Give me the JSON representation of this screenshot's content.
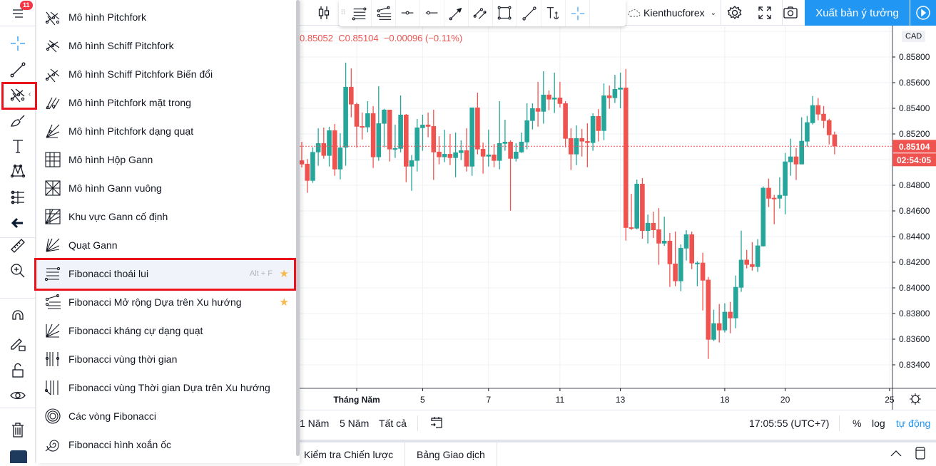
{
  "left_toolbar": {
    "notification_count": "11",
    "tools": [
      "menu-icon",
      "crosshair-icon",
      "trend-line-icon",
      "pitchfork-icon",
      "brush-icon",
      "text-icon",
      "pattern-icon",
      "prediction-icon",
      "back-arrow-icon",
      "ruler-icon",
      "zoom-in-icon",
      "magnet-icon",
      "lock-drawing-icon",
      "unlock-icon",
      "eye-icon",
      "trash-icon"
    ]
  },
  "menu": {
    "items": [
      {
        "label": "Mô hình Pitchfork",
        "icon": "pitchfork-icon"
      },
      {
        "label": "Mô hình Schiff Pitchfork",
        "icon": "schiff-pitchfork-icon"
      },
      {
        "label": "Mô hình Schiff Pitchfork Biến đổi",
        "icon": "modified-schiff-pitchfork-icon"
      },
      {
        "label": "Mô hình Pitchfork mặt trong",
        "icon": "inside-pitchfork-icon"
      },
      {
        "label": "Mô hình Pitchfork dạng quạt",
        "icon": "pitchfan-icon"
      },
      {
        "label": "Mô hình Hộp Gann",
        "icon": "gann-box-icon"
      },
      {
        "label": "Mô hình Gann vuông",
        "icon": "gann-square-icon"
      },
      {
        "label": "Khu vực Gann cố định",
        "icon": "gann-fixed-icon"
      },
      {
        "label": "Quạt Gann",
        "icon": "gann-fan-icon"
      },
      {
        "label": "Fibonacci thoái lui",
        "icon": "fib-retracement-icon",
        "shortcut": "Alt + F",
        "favorite": true,
        "selected": true
      },
      {
        "label": "Fibonacci Mở rộng Dựa trên Xu hướng",
        "icon": "fib-extension-icon",
        "favorite": true
      },
      {
        "label": "Fibonacci kháng cự dạng quạt",
        "icon": "fib-fan-icon"
      },
      {
        "label": "Fibonacci vùng thời gian",
        "icon": "fib-time-zone-icon"
      },
      {
        "label": "Fibonacci vùng Thời gian Dựa trên Xu hướng",
        "icon": "fib-trend-time-icon"
      },
      {
        "label": "Các vòng Fibonacci",
        "icon": "fib-circles-icon"
      },
      {
        "label": "Fibonacci hình xoắn ốc",
        "icon": "fib-spiral-icon"
      }
    ]
  },
  "top_toolbar": {
    "symbol": "Kienthucforex",
    "publish_label": "Xuất bản ý tưởng",
    "float_tools": [
      "fib-retracement-icon",
      "fib-extension-icon",
      "horizontal-ray-icon",
      "horizontal-line-icon",
      "arrow-icon",
      "parallel-channel-icon",
      "rectangle-icon",
      "trend-line-icon",
      "anchored-text-icon",
      "crosshair-icon"
    ]
  },
  "legend": {
    "text": "0.85052  C0.85104  −0.00096 (−0.11%)"
  },
  "currency": "CAD",
  "colors": {
    "up": "#26a69a",
    "down": "#ef5350",
    "accent": "#2196f3",
    "highlight": "#e8131b"
  },
  "chart_data": {
    "type": "candlestick",
    "price_ticks": [
      "0.85800",
      "0.85600",
      "0.85400",
      "0.85200",
      "0.84800",
      "0.84600",
      "0.84400",
      "0.84200",
      "0.84000",
      "0.83800",
      "0.83600",
      "0.83400"
    ],
    "x_ticks": [
      {
        "label": "Tháng Năm",
        "index": 10
      },
      {
        "label": "5",
        "index": 22
      },
      {
        "label": "7",
        "index": 34
      },
      {
        "label": "11",
        "index": 47
      },
      {
        "label": "13",
        "index": 58
      },
      {
        "label": "18",
        "index": 77
      },
      {
        "label": "20",
        "index": 88
      },
      {
        "label": "25",
        "index": 107
      }
    ],
    "last_price": "0.85104",
    "countdown": "02:54:05",
    "ylim": [
      0.833,
      0.859
    ],
    "candles": [
      [
        0.84994,
        0.85139,
        0.84939,
        0.84963
      ],
      [
        0.84967,
        0.85004,
        0.84741,
        0.84835
      ],
      [
        0.84835,
        0.85096,
        0.84819,
        0.85059
      ],
      [
        0.85057,
        0.85244,
        0.84952,
        0.85128
      ],
      [
        0.85128,
        0.8525,
        0.85007,
        0.8503
      ],
      [
        0.8503,
        0.85256,
        0.84946,
        0.85228
      ],
      [
        0.85228,
        0.85278,
        0.84874,
        0.84924
      ],
      [
        0.84924,
        0.85206,
        0.84846,
        0.85094
      ],
      [
        0.85094,
        0.85756,
        0.84952,
        0.85567
      ],
      [
        0.85567,
        0.85711,
        0.8533,
        0.8543
      ],
      [
        0.85433,
        0.85444,
        0.85093,
        0.85257
      ],
      [
        0.85261,
        0.85367,
        0.85157,
        0.85252
      ],
      [
        0.85252,
        0.85456,
        0.85213,
        0.85361
      ],
      [
        0.85361,
        0.85417,
        0.84935,
        0.85019
      ],
      [
        0.85019,
        0.85572,
        0.84991,
        0.85283
      ],
      [
        0.8528,
        0.85396,
        0.85096,
        0.85389
      ],
      [
        0.85389,
        0.85389,
        0.84985,
        0.8508
      ],
      [
        0.8508,
        0.85272,
        0.85013,
        0.85089
      ],
      [
        0.85085,
        0.855,
        0.85057,
        0.8535
      ],
      [
        0.8535,
        0.85356,
        0.84824,
        0.84946
      ],
      [
        0.84946,
        0.85035,
        0.84757,
        0.84994
      ],
      [
        0.84991,
        0.85317,
        0.84907,
        0.8525
      ],
      [
        0.85246,
        0.8535,
        0.85069,
        0.85272
      ],
      [
        0.85272,
        0.85367,
        0.85174,
        0.85257
      ],
      [
        0.85261,
        0.85389,
        0.84841,
        0.85057
      ],
      [
        0.85061,
        0.85183,
        0.84963,
        0.85019
      ],
      [
        0.85019,
        0.85233,
        0.8498,
        0.85044
      ],
      [
        0.85044,
        0.852,
        0.84957,
        0.85013
      ],
      [
        0.85013,
        0.85211,
        0.84863,
        0.85056
      ],
      [
        0.85052,
        0.8515,
        0.84996,
        0.85072
      ],
      [
        0.85072,
        0.85244,
        0.84907,
        0.84946
      ],
      [
        0.84946,
        0.85406,
        0.84874,
        0.85406
      ],
      [
        0.85406,
        0.85522,
        0.85041,
        0.8508
      ],
      [
        0.85083,
        0.85133,
        0.84891,
        0.85024
      ],
      [
        0.85024,
        0.85233,
        0.84946,
        0.85039
      ],
      [
        0.85039,
        0.85122,
        0.84941,
        0.84991
      ],
      [
        0.84991,
        0.85456,
        0.84924,
        0.85128
      ],
      [
        0.85124,
        0.85311,
        0.85069,
        0.85139
      ],
      [
        0.85139,
        0.8515,
        0.84602,
        0.85007
      ],
      [
        0.85007,
        0.85128,
        0.84985,
        0.85061
      ],
      [
        0.85057,
        0.85211,
        0.85052,
        0.85139
      ],
      [
        0.85135,
        0.85439,
        0.8508,
        0.85306
      ],
      [
        0.85302,
        0.85439,
        0.85235,
        0.854
      ],
      [
        0.854,
        0.85606,
        0.85257,
        0.85374
      ],
      [
        0.85374,
        0.85689,
        0.8528,
        0.85506
      ],
      [
        0.85506,
        0.85539,
        0.85385,
        0.85469
      ],
      [
        0.85469,
        0.85678,
        0.85363,
        0.85483
      ],
      [
        0.85483,
        0.85606,
        0.85407,
        0.85435
      ],
      [
        0.85439,
        0.85456,
        0.85096,
        0.85163
      ],
      [
        0.85167,
        0.85244,
        0.84919,
        0.85041
      ],
      [
        0.85041,
        0.85267,
        0.84957,
        0.85167
      ],
      [
        0.85167,
        0.85239,
        0.85024,
        0.85141
      ],
      [
        0.85144,
        0.85283,
        0.84941,
        0.8513
      ],
      [
        0.8513,
        0.85361,
        0.85069,
        0.85339
      ],
      [
        0.85339,
        0.85394,
        0.85141,
        0.85224
      ],
      [
        0.85224,
        0.85594,
        0.85152,
        0.855
      ],
      [
        0.855,
        0.85578,
        0.85396,
        0.8548
      ],
      [
        0.8548,
        0.85661,
        0.85441,
        0.8555
      ],
      [
        0.85546,
        0.85678,
        0.854,
        0.85561
      ],
      [
        0.85561,
        0.85707,
        0.84368,
        0.84468
      ],
      [
        0.84472,
        0.84733,
        0.84452,
        0.84463
      ],
      [
        0.84463,
        0.84844,
        0.84456,
        0.84811
      ],
      [
        0.84811,
        0.84856,
        0.84383,
        0.84444
      ],
      [
        0.84444,
        0.84572,
        0.84346,
        0.84506
      ],
      [
        0.84506,
        0.84594,
        0.84389,
        0.8445
      ],
      [
        0.84456,
        0.84622,
        0.8418,
        0.84346
      ],
      [
        0.84346,
        0.84556,
        0.84328,
        0.84367
      ],
      [
        0.84367,
        0.84428,
        0.84007,
        0.84185
      ],
      [
        0.84189,
        0.84439,
        0.84013,
        0.84052
      ],
      [
        0.84052,
        0.84339,
        0.83974,
        0.84311
      ],
      [
        0.84307,
        0.8445,
        0.84213,
        0.84417
      ],
      [
        0.84417,
        0.84439,
        0.84146,
        0.84191
      ],
      [
        0.84191,
        0.84207,
        0.84013,
        0.84196
      ],
      [
        0.84196,
        0.84274,
        0.83824,
        0.84057
      ],
      [
        0.84063,
        0.84085,
        0.83446,
        0.83596
      ],
      [
        0.83596,
        0.8383,
        0.83585,
        0.83724
      ],
      [
        0.83724,
        0.83874,
        0.83574,
        0.83669
      ],
      [
        0.83669,
        0.8388,
        0.83652,
        0.83813
      ],
      [
        0.83813,
        0.83891,
        0.83646,
        0.83763
      ],
      [
        0.83763,
        0.84096,
        0.83685,
        0.84007
      ],
      [
        0.84002,
        0.84446,
        0.83969,
        0.84219
      ],
      [
        0.84219,
        0.84296,
        0.84152,
        0.8418
      ],
      [
        0.84185,
        0.84357,
        0.84135,
        0.84163
      ],
      [
        0.84163,
        0.8438,
        0.84124,
        0.8433
      ],
      [
        0.84324,
        0.84791,
        0.84324,
        0.8478
      ],
      [
        0.8478,
        0.84852,
        0.8463,
        0.84696
      ],
      [
        0.84702,
        0.84724,
        0.84496,
        0.84696
      ],
      [
        0.84696,
        0.84863,
        0.84619,
        0.84724
      ],
      [
        0.84718,
        0.85052,
        0.84574,
        0.84985
      ],
      [
        0.8498,
        0.85163,
        0.84874,
        0.85024
      ],
      [
        0.85024,
        0.85091,
        0.84841,
        0.84963
      ],
      [
        0.84963,
        0.8533,
        0.84963,
        0.85146
      ],
      [
        0.85141,
        0.85341,
        0.85102,
        0.85291
      ],
      [
        0.85285,
        0.85496,
        0.85274,
        0.85424
      ],
      [
        0.85424,
        0.8548,
        0.85307,
        0.85352
      ],
      [
        0.85357,
        0.85418,
        0.85246,
        0.85302
      ],
      [
        0.85307,
        0.85318,
        0.85118,
        0.85191
      ],
      [
        0.85196,
        0.85218,
        0.85041,
        0.85104
      ]
    ]
  },
  "bottom_bar": {
    "ranges": [
      "1 Năm",
      "5 Năm",
      "Tất cả"
    ],
    "time": "17:05:55 (UTC+7)",
    "percent": "%",
    "log": "log",
    "auto": "tự động"
  },
  "bottom_tabs": [
    "Kiểm tra Chiến lược",
    "Bảng Giao dịch"
  ]
}
